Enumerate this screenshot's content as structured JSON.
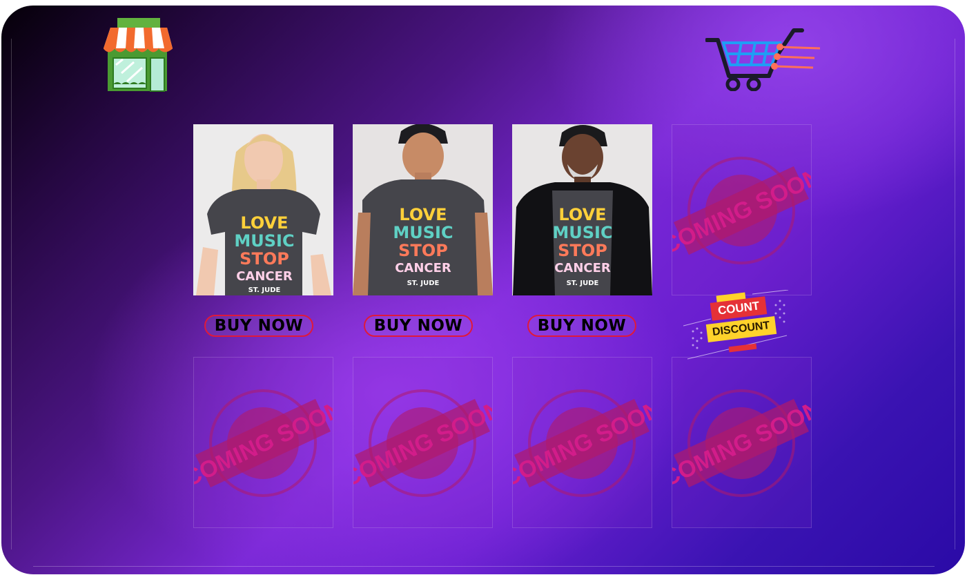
{
  "colors": {
    "accent_red": "#e0193a",
    "bg_purple": "#7a28d6",
    "bg_dark": "#050008"
  },
  "header": {
    "store_icon": "storefront-icon",
    "cart_icon": "fast-shopping-cart-icon"
  },
  "products": [
    {
      "shirt_text": [
        "LOVE",
        "MUSIC",
        "STOP",
        "CANCER"
      ],
      "brand": "ST. JUDE",
      "button": "BUY NOW"
    },
    {
      "shirt_text": [
        "LOVE",
        "MUSIC",
        "STOP",
        "CANCER"
      ],
      "brand": "ST. JUDE",
      "button": "BUY NOW"
    },
    {
      "shirt_text": [
        "LOVE",
        "MUSIC",
        "STOP",
        "CANCER"
      ],
      "brand": "ST. JUDE",
      "button": "BUY NOW"
    }
  ],
  "coming_soon_stamp": "COMING SOON",
  "discount_badge": {
    "line1": "COUNT",
    "line2": "DISCOUNT"
  }
}
